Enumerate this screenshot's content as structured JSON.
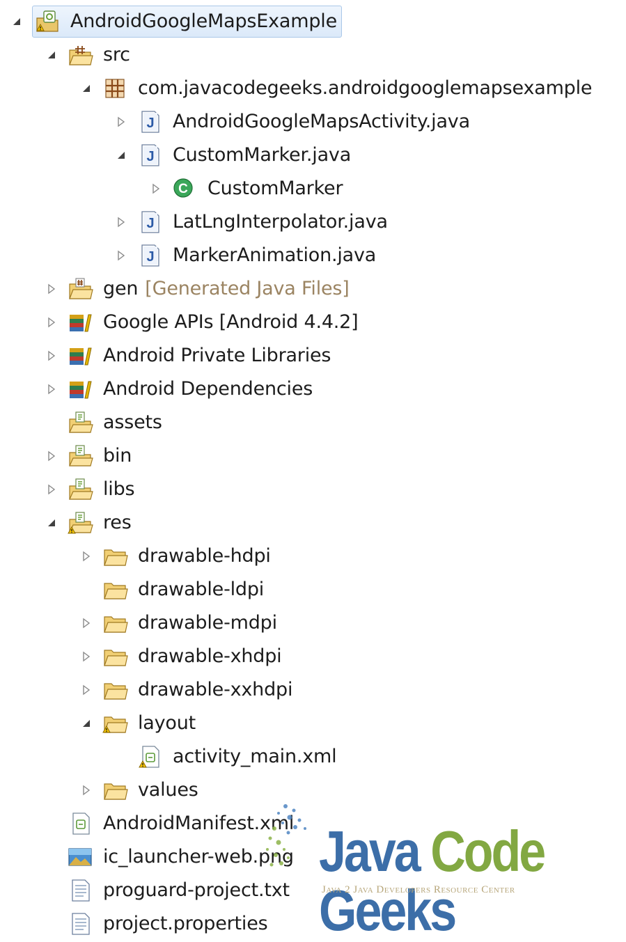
{
  "tree": [
    {
      "label": "AndroidGoogleMapsExample",
      "icon": "android-project-icon",
      "twisty": "expanded",
      "selected": true
    },
    {
      "label": "src",
      "icon": "source-folder-icon",
      "twisty": "expanded"
    },
    {
      "label": "com.javacodegeeks.androidgooglemapsexample",
      "icon": "package-icon",
      "twisty": "expanded"
    },
    {
      "label": "AndroidGoogleMapsActivity.java",
      "icon": "java-file-icon",
      "twisty": "collapsed"
    },
    {
      "label": "CustomMarker.java",
      "icon": "java-file-icon",
      "twisty": "expanded"
    },
    {
      "label": "CustomMarker",
      "icon": "class-icon",
      "twisty": "collapsed"
    },
    {
      "label": "LatLngInterpolator.java",
      "icon": "java-file-icon",
      "twisty": "collapsed"
    },
    {
      "label": "MarkerAnimation.java",
      "icon": "java-file-icon",
      "twisty": "collapsed"
    },
    {
      "label": "gen",
      "decoration": "[Generated Java Files]",
      "icon": "generated-source-folder-icon",
      "twisty": "collapsed"
    },
    {
      "label": "Google APIs [Android 4.4.2]",
      "icon": "library-icon",
      "twisty": "collapsed"
    },
    {
      "label": "Android Private Libraries",
      "icon": "library-icon",
      "twisty": "collapsed"
    },
    {
      "label": "Android Dependencies",
      "icon": "library-icon",
      "twisty": "collapsed"
    },
    {
      "label": "assets",
      "icon": "resource-folder-icon",
      "twisty": "none"
    },
    {
      "label": "bin",
      "icon": "resource-folder-icon",
      "twisty": "collapsed"
    },
    {
      "label": "libs",
      "icon": "resource-folder-icon",
      "twisty": "collapsed"
    },
    {
      "label": "res",
      "icon": "resource-folder-icon",
      "twisty": "expanded",
      "warning": true
    },
    {
      "label": "drawable-hdpi",
      "icon": "folder-icon",
      "twisty": "collapsed"
    },
    {
      "label": "drawable-ldpi",
      "icon": "folder-icon",
      "twisty": "none"
    },
    {
      "label": "drawable-mdpi",
      "icon": "folder-icon",
      "twisty": "collapsed"
    },
    {
      "label": "drawable-xhdpi",
      "icon": "folder-icon",
      "twisty": "collapsed"
    },
    {
      "label": "drawable-xxhdpi",
      "icon": "folder-icon",
      "twisty": "collapsed"
    },
    {
      "label": "layout",
      "icon": "folder-icon",
      "twisty": "expanded",
      "warning": true
    },
    {
      "label": "activity_main.xml",
      "icon": "xml-file-icon",
      "twisty": "none",
      "warning": true
    },
    {
      "label": "values",
      "icon": "folder-icon",
      "twisty": "collapsed"
    },
    {
      "label": "AndroidManifest.xml",
      "icon": "xml-file-icon",
      "twisty": "none"
    },
    {
      "label": "ic_launcher-web.png",
      "icon": "image-file-icon",
      "twisty": "none"
    },
    {
      "label": "proguard-project.txt",
      "icon": "text-file-icon",
      "twisty": "none"
    },
    {
      "label": "project.properties",
      "icon": "text-file-icon",
      "twisty": "none"
    }
  ],
  "watermark": {
    "brand_java": "Java",
    "brand_code": "Code",
    "brand_geeks": "Geeks",
    "tagline": "Java 2 Java Developers Resource Center"
  }
}
